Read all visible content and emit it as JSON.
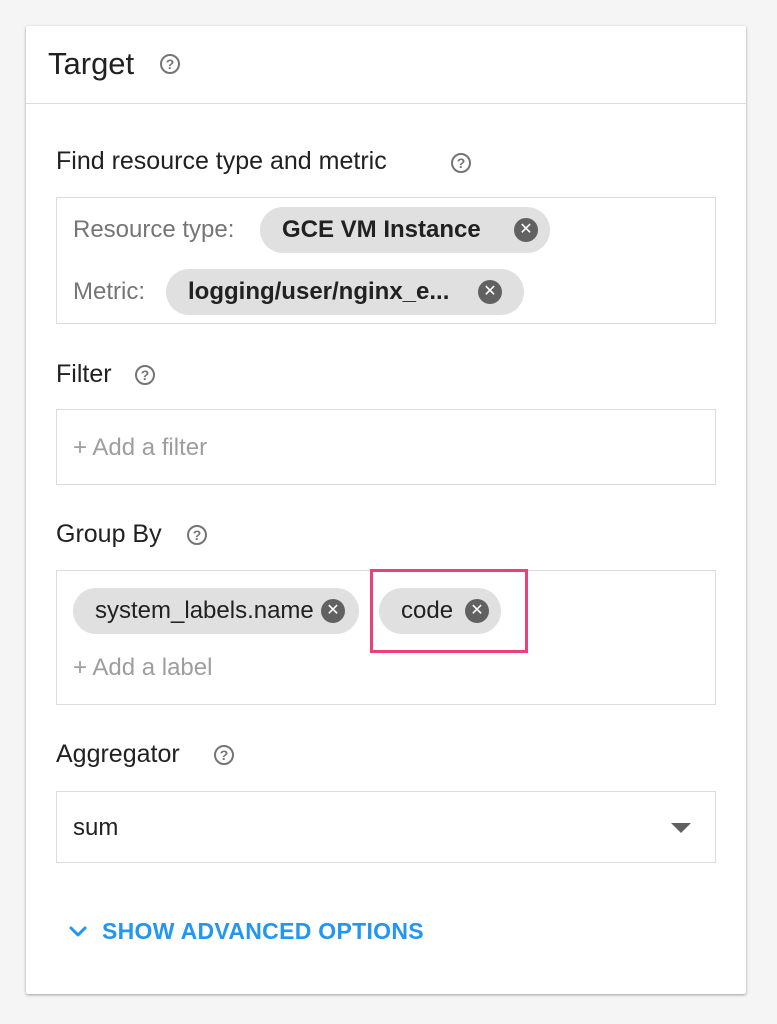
{
  "panel": {
    "title": "Target",
    "help_icon": "help-circle-icon"
  },
  "resource_section": {
    "label": "Find resource type and metric",
    "resource_type_label": "Resource type:",
    "resource_type_value": "GCE VM Instance",
    "metric_label": "Metric:",
    "metric_value": "logging/user/nginx_e..."
  },
  "filter_section": {
    "label": "Filter",
    "placeholder": "+ Add a filter"
  },
  "group_by_section": {
    "label": "Group By",
    "chips": [
      "system_labels.name",
      "code"
    ],
    "placeholder": "+ Add a label"
  },
  "aggregator_section": {
    "label": "Aggregator",
    "selected": "sum"
  },
  "advanced": {
    "label": "SHOW ADVANCED OPTIONS"
  },
  "colors": {
    "accent": "#2196f3",
    "highlight": "#ec407a",
    "chip_bg": "#e0e0e0"
  }
}
